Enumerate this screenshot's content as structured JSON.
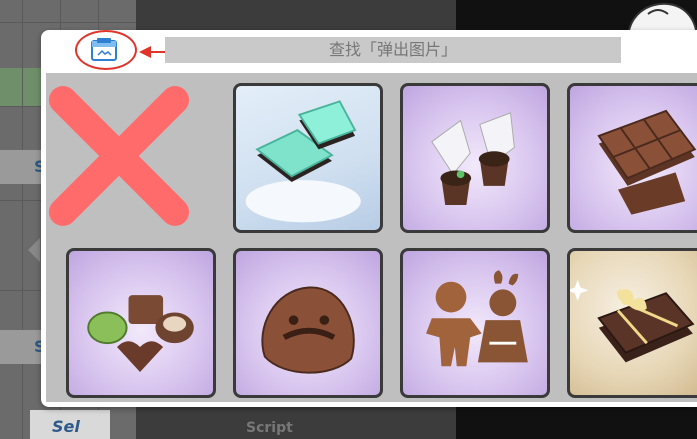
{
  "background": {
    "sel_labels": [
      "Se",
      "S",
      "Sel"
    ],
    "script_label": "Script"
  },
  "popup": {
    "search_placeholder": "查找「弹出图片」",
    "icon_name": "image-popup-icon",
    "highlight_color": "#e0342b"
  },
  "tiles": [
    {
      "name": "close",
      "icon": "red-x-icon"
    },
    {
      "name": "mint-chocolate",
      "icon": "mint-chocolate-icon"
    },
    {
      "name": "chocolate-muffin-bags",
      "icon": "muffin-bags-icon"
    },
    {
      "name": "chocolate-bar",
      "icon": "chocolate-bar-icon"
    },
    {
      "name": "chocolate-bonbons",
      "icon": "bonbons-icon"
    },
    {
      "name": "chocolate-blob",
      "icon": "chocolate-blob-icon"
    },
    {
      "name": "gingerbread-couple",
      "icon": "gingerbread-icon"
    },
    {
      "name": "chocolate-gift-box",
      "icon": "gift-box-icon"
    }
  ],
  "colors": {
    "x_red": "#ff6b6b",
    "tile_border": "#3a3a3a"
  }
}
